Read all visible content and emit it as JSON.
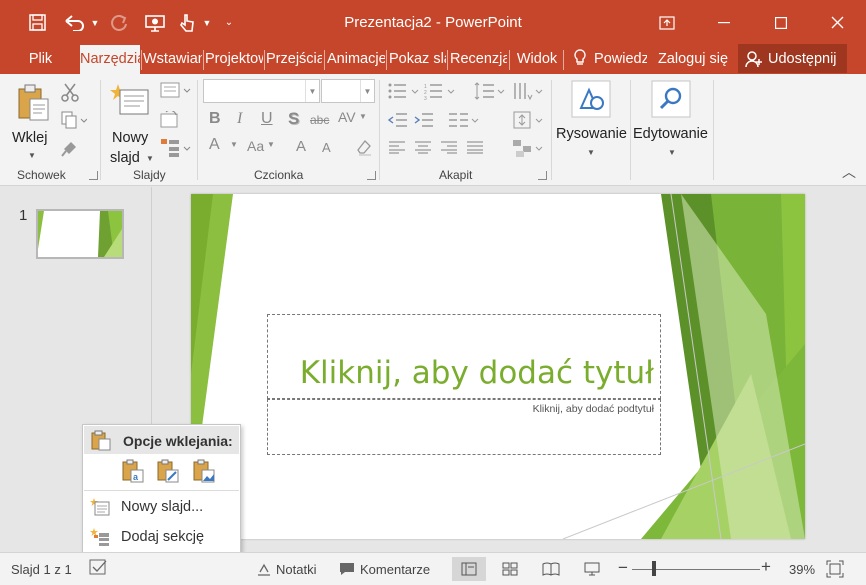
{
  "window": {
    "title": "Prezentacja2 - PowerPoint"
  },
  "tabs": [
    {
      "label": "Plik"
    },
    {
      "label": "Narzędzia główne"
    },
    {
      "label": "Wstawianie"
    },
    {
      "label": "Projektowanie"
    },
    {
      "label": "Przejścia"
    },
    {
      "label": "Animacje"
    },
    {
      "label": "Pokaz slajdów"
    },
    {
      "label": "Recenzja"
    },
    {
      "label": "Widok"
    }
  ],
  "tell_me": "Powiedz mi",
  "sign_in": "Zaloguj się",
  "share": "Udostępnij",
  "ribbon": {
    "schowek": {
      "label": "Schowek",
      "paste": "Wklej"
    },
    "slajdy": {
      "label": "Slajdy",
      "new_slide_1": "Nowy",
      "new_slide_2": "slajd"
    },
    "czcionka": {
      "label": "Czcionka",
      "font_name": "",
      "font_size": "",
      "bold": "B",
      "italic": "I",
      "underline": "U",
      "shadow": "S",
      "strike": "abc",
      "spacing": "AV",
      "font_color": "A",
      "case": "Aa",
      "grow": "A",
      "shrink": "A"
    },
    "akapit": {
      "label": "Akapit"
    },
    "rysowanie": {
      "label": "Rysowanie"
    },
    "edytowanie": {
      "label": "Edytowanie"
    }
  },
  "thumbnail": {
    "number": "1"
  },
  "slide": {
    "title_placeholder": "Kliknij, aby dodać tytuł",
    "subtitle_placeholder": "Kliknij, aby dodać podtytuł",
    "accent_color": "#7aad2e"
  },
  "context_menu": {
    "paste_options_label": "Opcje wklejania:",
    "items": [
      {
        "label": "Nowy slajd..."
      },
      {
        "label": "Dodaj sekcję"
      }
    ]
  },
  "statusbar": {
    "slide_counter": "Slajd 1 z 1",
    "notes": "Notatki",
    "comments": "Komentarze",
    "zoom": "39%"
  },
  "colors": {
    "brand": "#c5462a",
    "brand_dark": "#9f361f"
  }
}
